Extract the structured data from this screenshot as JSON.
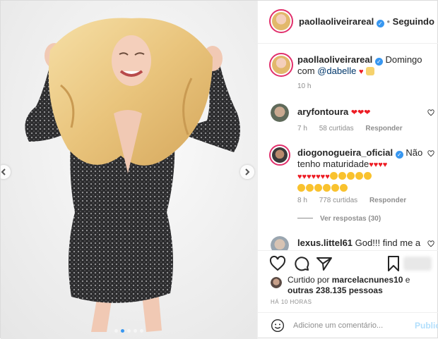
{
  "post": {
    "author": "paollaoliveirareal",
    "follow_status": "Seguindo",
    "separator": "•",
    "carousel": {
      "total": 5,
      "current": 2
    }
  },
  "caption": {
    "username": "paollaoliveirareal",
    "text": "Domingo com",
    "mention": "@dabelle",
    "time": "10 h"
  },
  "comments": [
    {
      "username": "aryfontoura",
      "text": "❤❤❤",
      "time": "7 h",
      "likes": "58 curtidas",
      "reply": "Responder"
    },
    {
      "username": "diogonogueira_oficial",
      "text": "Não tenho maturidade",
      "time": "8 h",
      "likes": "778 curtidas",
      "reply": "Responder",
      "view_replies": "Ver respostas (30)"
    },
    {
      "username": "lexus.littel61",
      "text": "God!!! find me a"
    }
  ],
  "actions": {
    "liked_by_prefix": "Curtido por",
    "liked_by_user": "marcelacnunes10",
    "liked_by_connector": "e",
    "liked_by_others": "outras 238.135 pessoas",
    "post_time": "HÁ 10 HORAS"
  },
  "add_comment": {
    "placeholder": "Adicione um comentário...",
    "publish": "Publicar"
  },
  "colors": {
    "accent": "#3897f0",
    "heart": "#ed1c24",
    "publish_disabled": "#b2dffc"
  },
  "icons": [
    "heart-icon",
    "comment-icon",
    "share-icon",
    "bookmark-icon",
    "emoji-icon",
    "verified-icon",
    "chevron-left-icon",
    "chevron-right-icon"
  ]
}
